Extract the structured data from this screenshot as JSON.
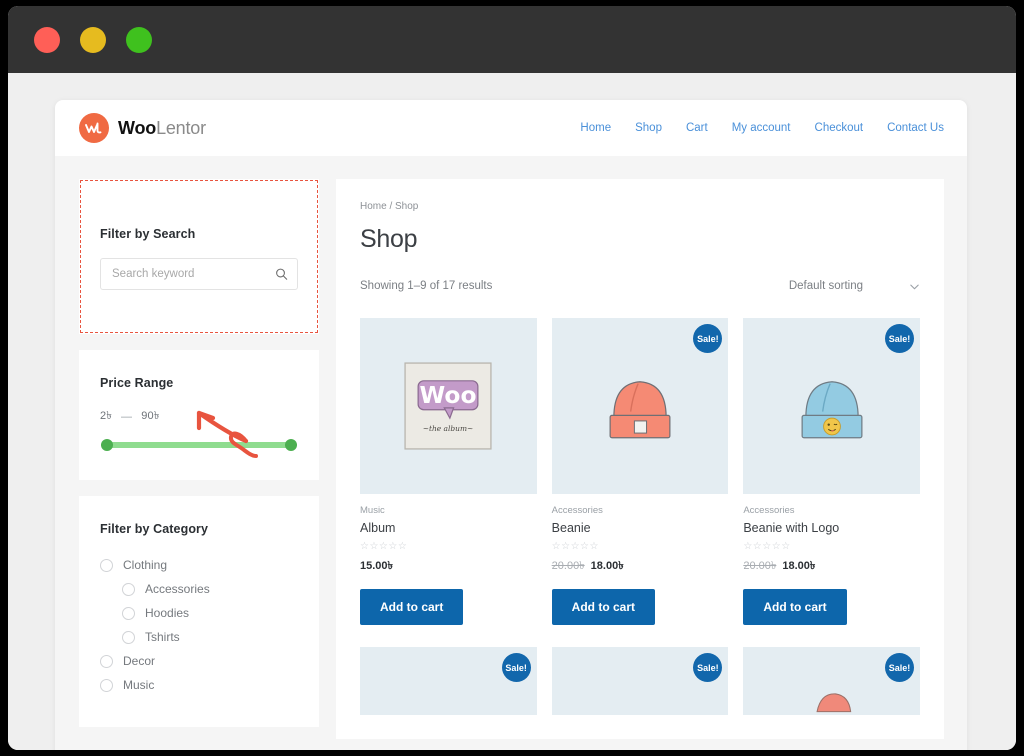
{
  "window": {
    "traffic_lights": [
      "close",
      "minimize",
      "maximize"
    ]
  },
  "header": {
    "brand_bold": "Woo",
    "brand_light": "Lentor",
    "nav": [
      {
        "label": "Home"
      },
      {
        "label": "Shop"
      },
      {
        "label": "Cart"
      },
      {
        "label": "My account"
      },
      {
        "label": "Checkout"
      },
      {
        "label": "Contact Us"
      }
    ]
  },
  "sidebar": {
    "search_widget": {
      "title": "Filter by Search",
      "input_value": "",
      "placeholder": "Search keyword",
      "icon": "search-icon",
      "selected": true
    },
    "price_widget": {
      "title": "Price Range",
      "min_label": "2৳",
      "dash": "—",
      "max_label": "90৳",
      "min_value": 2,
      "max_value": 90,
      "track_color": "#8fdc8f",
      "handle_color": "#4caf50"
    },
    "category_widget": {
      "title": "Filter by Category",
      "items": [
        {
          "label": "Clothing",
          "level": 0,
          "checked": false
        },
        {
          "label": "Accessories",
          "level": 1,
          "checked": false
        },
        {
          "label": "Hoodies",
          "level": 1,
          "checked": false
        },
        {
          "label": "Tshirts",
          "level": 1,
          "checked": false
        },
        {
          "label": "Decor",
          "level": 0,
          "checked": false
        },
        {
          "label": "Music",
          "level": 0,
          "checked": false
        }
      ]
    }
  },
  "main": {
    "breadcrumb": "Home / Shop",
    "title": "Shop",
    "result_count": "Showing 1–9 of 17 results",
    "sorting": {
      "selected": "Default sorting",
      "icon": "chevron-down-icon"
    },
    "badge_label": "Sale!",
    "stars_empty": "☆☆☆☆☆",
    "add_to_cart_label": "Add to cart",
    "products": [
      {
        "category": "Music",
        "name": "Album",
        "rating": 0,
        "price_old": "",
        "price_now": "15.00৳",
        "on_sale": false,
        "image": "album-cover-woo"
      },
      {
        "category": "Accessories",
        "name": "Beanie",
        "rating": 0,
        "price_old": "20.00৳",
        "price_now": "18.00৳",
        "on_sale": true,
        "image": "beanie-salmon"
      },
      {
        "category": "Accessories",
        "name": "Beanie with Logo",
        "rating": 0,
        "price_old": "20.00৳",
        "price_now": "18.00৳",
        "on_sale": true,
        "image": "beanie-blue-emoji"
      }
    ],
    "products_row2": [
      {
        "on_sale": true,
        "image": "product-placeholder"
      },
      {
        "on_sale": true,
        "image": "product-placeholder"
      },
      {
        "on_sale": true,
        "image": "product-salmon-partial"
      }
    ]
  },
  "annotation": {
    "type": "arrow",
    "color": "#e8543f",
    "points_to": "search-filter-widget"
  },
  "colors": {
    "brand": "#f06a43",
    "link": "#4a90d9",
    "button": "#0d66ab",
    "badge": "#1267ac",
    "slider": "#4caf50",
    "annotation": "#e8543f",
    "thumb_bg": "#e4edf2"
  }
}
